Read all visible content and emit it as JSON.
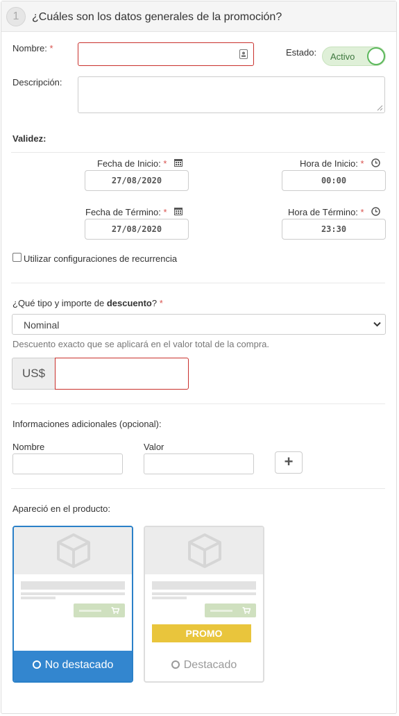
{
  "header": {
    "step_number": "1",
    "title": "¿Cuáles son los datos generales de la promoción?"
  },
  "form": {
    "name_label": "Nombre:",
    "required_mark": "*",
    "status_label": "Estado:",
    "status_toggle": "Activo",
    "description_label": "Descripción:",
    "validity_label": "Validez:",
    "start_date_label": "Fecha de Inicio:",
    "start_date": "27/08/2020",
    "start_time_label": "Hora de Inicio:",
    "start_time": "00:00",
    "end_date_label": "Fecha de Término:",
    "end_date": "27/08/2020",
    "end_time_label": "Hora de Término:",
    "end_time": "23:30",
    "recurrence_label": "Utilizar configuraciones de recurrencia",
    "discount_q_prefix": "¿Qué tipo y importe de ",
    "discount_q_bold": "descuento",
    "discount_q_suffix": "?",
    "discount_type": "Nominal",
    "discount_help": "Descuento exacto que se aplicará en el valor total de la compra.",
    "currency": "US$",
    "additional_label": "Informaciones adicionales (opcional):",
    "extra_name_label": "Nombre",
    "extra_value_label": "Valor",
    "add_button": "+",
    "appeared_label": "Apareció en el producto:",
    "option_not_featured": "No destacado",
    "option_featured": "Destacado",
    "promo_ribbon": "PROMO"
  },
  "colors": {
    "accent": "#3386cf",
    "error": "#c9302c",
    "toggle_bg": "#dff0d8",
    "promo": "#e9c53c"
  },
  "icons": [
    "calendar-icon",
    "clock-icon",
    "cube-icon",
    "cart-icon",
    "chevron-down-icon",
    "contact-card-icon"
  ]
}
